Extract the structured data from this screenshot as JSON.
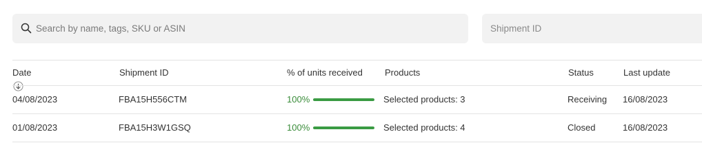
{
  "search": {
    "placeholder": "Search by name, tags, SKU or ASIN",
    "icon": "search-icon"
  },
  "shipment_filter": {
    "placeholder": "Shipment ID"
  },
  "table": {
    "columns": [
      "Date",
      "Shipment ID",
      "% of units received",
      "Products",
      "Status",
      "Last update"
    ],
    "sort_icon": "arrow-down-circle-icon",
    "rows": [
      {
        "date": "04/08/2023",
        "shipment_id": "FBA15H556CTM",
        "received_label": "100%",
        "received_fraction": 1.0,
        "products": "Selected products: 3",
        "status": "Receiving",
        "last_update": "16/08/2023"
      },
      {
        "date": "01/08/2023",
        "shipment_id": "FBA15H3W1GSQ",
        "received_label": "100%",
        "received_fraction": 1.0,
        "products": "Selected products: 4",
        "status": "Closed",
        "last_update": "16/08/2023"
      }
    ]
  },
  "colors": {
    "progress": "#3a9b43",
    "progress_text": "#3a8c3a"
  }
}
